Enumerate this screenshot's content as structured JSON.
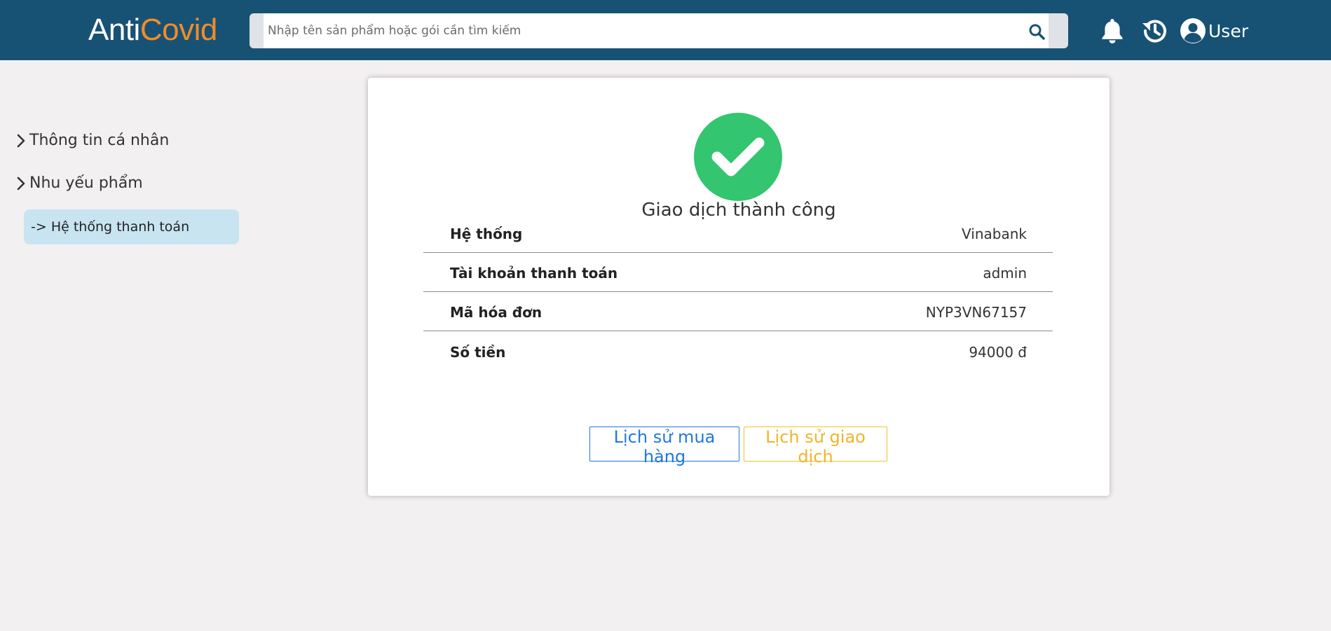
{
  "header": {
    "logo_part1": "Anti",
    "logo_part2": "Covid",
    "search_placeholder": "Nhập tên sản phẩm hoặc gói cần tìm kiếm",
    "user_label": "User",
    "icons": [
      "search-icon",
      "bell-icon",
      "history-icon",
      "user-circle-icon"
    ]
  },
  "sidebar": {
    "items": [
      {
        "label": "Thông tin cá nhân",
        "icon": "chevron-right-icon"
      },
      {
        "label": "Nhu yếu phẩm",
        "icon": "chevron-right-icon"
      }
    ],
    "active_label": "-> Hệ thống thanh toán"
  },
  "receipt": {
    "status_icon": "check-circle-icon",
    "status": "Giao dịch thành công",
    "rows": [
      {
        "label": "Hệ thống",
        "value": "Vinabank"
      },
      {
        "label": "Tài khoản thanh toán",
        "value": "admin"
      },
      {
        "label": "Mã hóa đơn",
        "value": "NYP3VN67157"
      },
      {
        "label": "Số tiền",
        "value": "94000 đ"
      }
    ],
    "btn_purchase_history": "Lịch sử mua hàng",
    "btn_transaction_history": "Lịch sử giao dịch"
  },
  "colors": {
    "header_bg": "#175275",
    "logo_accent": "#f28c28",
    "success": "#33c56f",
    "primary": "#1f78e0",
    "warning": "#f0b429",
    "active_bg": "#c8e4f1",
    "page_bg": "#f2f0f1"
  }
}
